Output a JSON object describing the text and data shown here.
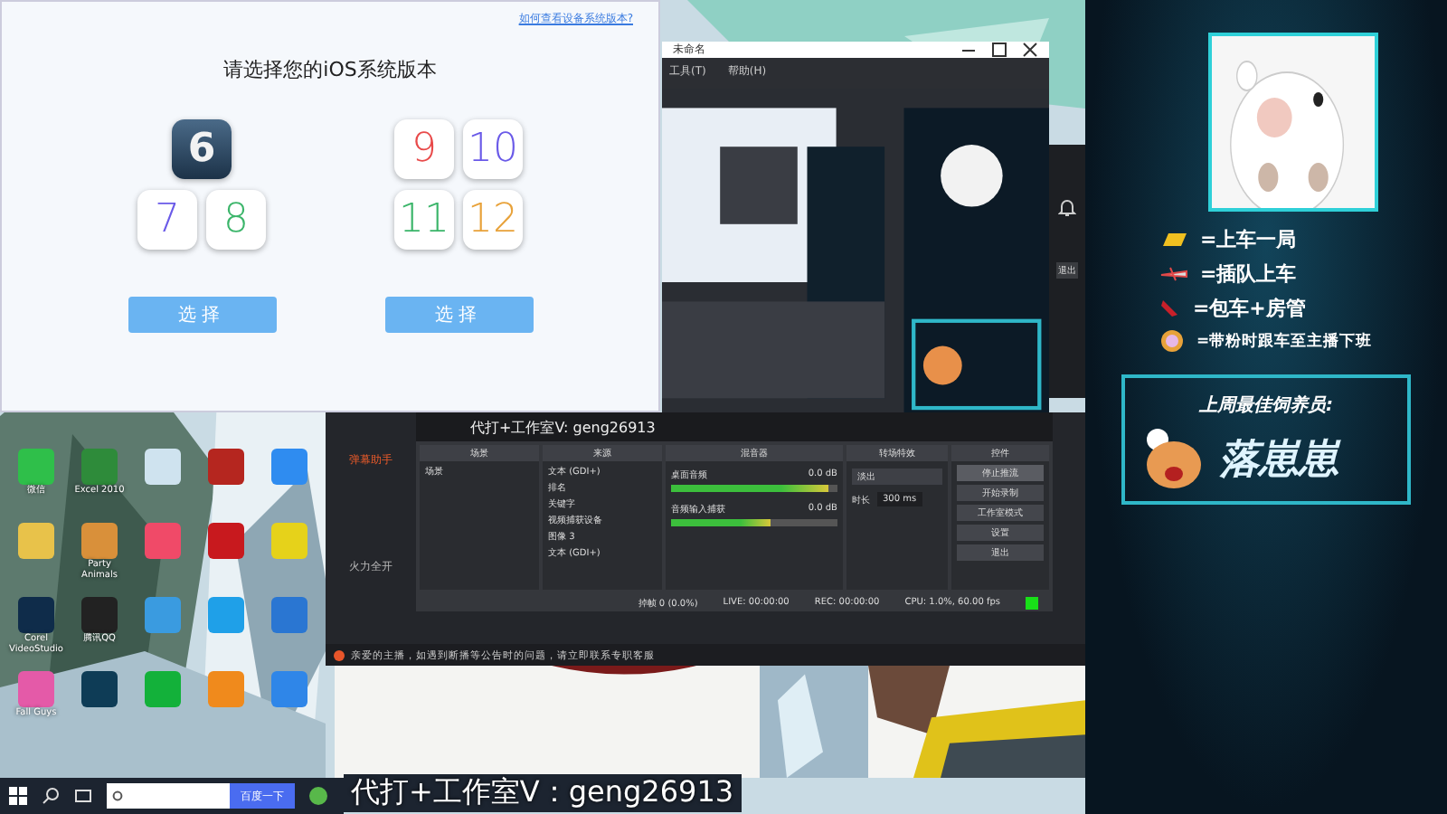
{
  "dialog": {
    "help_link": "如何查看设备系统版本?",
    "title": "请选择您的iOS系统版本",
    "groups": [
      {
        "versions": [
          {
            "label": "6",
            "kind": "dark"
          },
          {
            "label": "7",
            "kind": "light"
          },
          {
            "label": "8",
            "kind": "light"
          }
        ],
        "button": "选择"
      },
      {
        "versions": [
          {
            "label": "9",
            "kind": "light"
          },
          {
            "label": "10",
            "kind": "light"
          },
          {
            "label": "11",
            "kind": "light"
          },
          {
            "label": "12",
            "kind": "light"
          }
        ],
        "button": "选择"
      }
    ]
  },
  "capture_window": {
    "title": "未命名",
    "menu": [
      "工具(T)",
      "帮助(H)"
    ]
  },
  "desktop_icons": [
    {
      "label": "微信",
      "color": "#2fbf4a"
    },
    {
      "label": "Excel 2010",
      "color": "#2e8b3a"
    },
    {
      "color": "#cfe3ef"
    },
    {
      "color": "#b5261f"
    },
    {
      "color": "#2f8cf0"
    },
    {
      "color": "#e8c24a"
    },
    {
      "label": "Party Animals",
      "color": "#d9903a"
    },
    {
      "color": "#f04a68"
    },
    {
      "color": "#c8191e"
    },
    {
      "color": "#e6d21a"
    },
    {
      "label": "Corel VideoStudio",
      "color": "#0f2c4a"
    },
    {
      "label": "腾讯QQ",
      "color": "#222222"
    },
    {
      "color": "#3a9be0"
    },
    {
      "color": "#1fa0e8"
    },
    {
      "color": "#2a76d2"
    },
    {
      "label": "Fall Guys",
      "color": "#e45aa8"
    },
    {
      "color": "#0e3c56"
    },
    {
      "color": "#13b13a"
    },
    {
      "color": "#f08a1c"
    },
    {
      "color": "#2f86e8"
    }
  ],
  "taskbar": {
    "search_button": "百度一下"
  },
  "streamer_tool": {
    "sidebar": [
      "弹幕助手",
      "火力全开"
    ],
    "notice": "亲爱的主播，如遇到断播等公告时的问题，请立即联系专职客服"
  },
  "obs": {
    "panels": [
      "场景",
      "来源",
      "混音器",
      "转场特效",
      "控件"
    ],
    "scenes": [
      "场景"
    ],
    "sources": [
      "文本 (GDI+)",
      "排名",
      "关键字",
      "视频捕获设备",
      "图像 3",
      "文本 (GDI+)"
    ],
    "mixer": [
      {
        "name": "桌面音频",
        "reading": "0.0 dB",
        "level": 0.95
      },
      {
        "name": "音频输入捕获",
        "reading": "0.0 dB",
        "level": 0.6
      }
    ],
    "transition": {
      "value": "淡出",
      "duration_label": "时长",
      "duration": "300 ms"
    },
    "controls": [
      "停止推流",
      "开始录制",
      "工作室模式",
      "设置",
      "退出"
    ],
    "status": [
      "掉帧 0 (0.0%)",
      "LIVE: 00:00:00",
      "REC: 00:00:00",
      "CPU: 1.0%, 60.00 fps"
    ],
    "preview_caption": "代打+工作室V: geng26913"
  },
  "caption": "代打+工作室V：geng26913",
  "side_panel": {
    "exit_button": "退出"
  },
  "overlay": {
    "legend": [
      {
        "text": "=上车一局",
        "kind": "gold"
      },
      {
        "text": "=插队上车",
        "kind": "plane"
      },
      {
        "text": "=包车+房管",
        "kind": "rocket"
      },
      {
        "text": "=带粉时跟车至主播下班",
        "kind": "badge"
      }
    ],
    "card_title": "上周最佳饲养员:",
    "card_name": "落崽崽"
  }
}
